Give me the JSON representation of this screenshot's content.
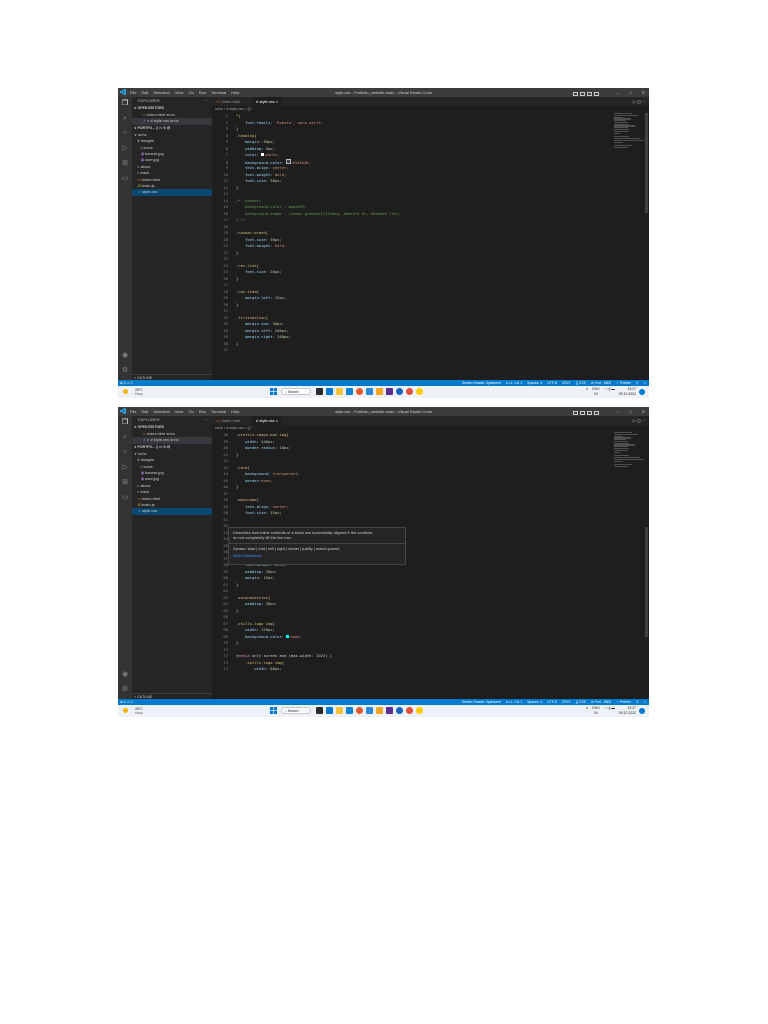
{
  "colors": {
    "accent": "#007acc",
    "selection": "#094771"
  },
  "window": {
    "menu": [
      "File",
      "Edit",
      "Selection",
      "View",
      "Go",
      "Run",
      "Terminal",
      "Help"
    ],
    "title": "style.css - Portfolio_website-main - Visual Studio Code",
    "controls": [
      "–",
      "□",
      "✕"
    ]
  },
  "sidebar": {
    "header": "EXPLORER",
    "open_editors": "OPEN EDITORS",
    "open_files": [
      {
        "label": "index.html  src\\s",
        "icon": "<>",
        "color": "#e37933",
        "active": false
      },
      {
        "label": "× # style.css  src\\s",
        "icon": "#",
        "color": "#519aba",
        "active": true
      }
    ],
    "project": "PORTFO...",
    "tree": [
      {
        "label": "∨ src\\s",
        "indent": 2,
        "icon": "",
        "color": "#cccccc"
      },
      {
        "label": "∨ images",
        "indent": 5,
        "icon": "",
        "color": "#cccccc"
      },
      {
        "label": "> icons",
        "indent": 8,
        "icon": "",
        "color": "#cccccc"
      },
      {
        "label": "banner.jpg",
        "indent": 8,
        "icon": "▣",
        "color": "#a074c4"
      },
      {
        "label": "user.jpg",
        "indent": 8,
        "icon": "▣",
        "color": "#a074c4"
      },
      {
        "label": "> about",
        "indent": 5,
        "icon": "",
        "color": "#cccccc"
      },
      {
        "label": "> track",
        "indent": 5,
        "icon": "",
        "color": "#cccccc"
      },
      {
        "label": "index.html",
        "indent": 5,
        "icon": "<>",
        "color": "#e37933"
      },
      {
        "label": "main.js",
        "indent": 5,
        "icon": "JS",
        "color": "#cbcb41"
      },
      {
        "label": "style.css",
        "indent": 5,
        "icon": "#",
        "color": "#519aba",
        "selected": true
      }
    ],
    "outline": "> OUTLINE",
    "timeline": "> TIMELINE"
  },
  "tabs": [
    {
      "label": "index.html",
      "icon": "<>",
      "color": "#e37933",
      "active": false
    },
    {
      "label": "# style.css  ×",
      "icon": "",
      "color": "#519aba",
      "active": true
    }
  ],
  "tab_actions": "▷  ◫  ···",
  "statusbar": {
    "left": "⊗ 0 ⚠ 0",
    "right": [
      "Screen Reader Optimized",
      "Ln 1, Col 1",
      "Spaces: 4",
      "UTF-8",
      "CRLF",
      "{} CSS",
      "⊘ Port : 5500",
      "✓ Prettier",
      "⚲",
      "♫"
    ]
  },
  "taskbar": {
    "weather_temp": "28°C",
    "weather_desc": "Hazy",
    "search": "Search",
    "lang": "ENG",
    "lang2": "IN",
    "time": "13:27",
    "date": "09-12-2022",
    "apps": [
      "#2b2b2b",
      "#0078d4",
      "#f3c13a",
      "#0a84d6",
      "#e4572e",
      "#2b88d8",
      "#f5a623",
      "#5c2d91",
      "#1565c0",
      "#e44c3c",
      "#ffcc00"
    ]
  },
  "screens": [
    {
      "breadcrumb": "src\\s > # style.css > {} *",
      "code": [
        {
          "n": "1",
          "t": [
            [
              "*{",
              "sel"
            ]
          ]
        },
        {
          "n": "2",
          "t": [
            [
              "    font-family: ",
              "prop"
            ],
            [
              "'Roboto'",
              "val"
            ],
            [
              ", sans-serif;",
              "val"
            ]
          ]
        },
        {
          "n": "3",
          "t": [
            [
              "}",
              "pn"
            ]
          ]
        },
        {
          "n": "4",
          "t": [
            [
              ".heading{",
              "sel"
            ]
          ]
        },
        {
          "n": "5",
          "t": [
            [
              "    margin: ",
              "prop"
            ],
            [
              "50px;",
              "num"
            ]
          ]
        },
        {
          "n": "6",
          "t": [
            [
              "    padding: ",
              "prop"
            ],
            [
              "5px;",
              "num"
            ]
          ]
        },
        {
          "n": "7",
          "t": [
            [
              "    color: ",
              "prop"
            ],
            [
              "■",
              "sw-white"
            ],
            [
              "white;",
              "val"
            ]
          ]
        },
        {
          "n": "8",
          "t": [
            [
              "    background-color: ",
              "prop"
            ],
            [
              "■",
              "sw-dark"
            ],
            [
              "#343a40;",
              "val"
            ]
          ]
        },
        {
          "n": "9",
          "t": [
            [
              "    text-align: ",
              "prop"
            ],
            [
              "center;",
              "val"
            ]
          ]
        },
        {
          "n": "10",
          "t": [
            [
              "    font-weight: ",
              "prop"
            ],
            [
              "bold;",
              "val"
            ]
          ]
        },
        {
          "n": "11",
          "t": [
            [
              "    font-size: ",
              "prop"
            ],
            [
              "30px;",
              "num"
            ]
          ]
        },
        {
          "n": "12",
          "t": [
            [
              "}",
              "pn"
            ]
          ]
        },
        {
          "n": "13",
          "t": []
        },
        {
          "n": "14",
          "t": [
            [
              "/* .navbar{",
              "cmt"
            ]
          ]
        },
        {
          "n": "15",
          "t": [
            [
              "    background-color : #aea3f9;",
              "cmt"
            ]
          ]
        },
        {
          "n": "16",
          "t": [
            [
              "    background-image : linear-gradient(315deg, #aea3f9 0%, #5e6ee6 74%);",
              "cmt"
            ]
          ]
        },
        {
          "n": "17",
          "t": [
            [
              "} */",
              "cmt"
            ]
          ]
        },
        {
          "n": "18",
          "t": []
        },
        {
          "n": "19",
          "t": [
            [
              ".navbar-brand{",
              "sel"
            ]
          ]
        },
        {
          "n": "20",
          "t": [
            [
              "    font-size: ",
              "prop"
            ],
            [
              "30px;",
              "num"
            ]
          ]
        },
        {
          "n": "21",
          "t": [
            [
              "    font-weight: ",
              "prop"
            ],
            [
              "bold;",
              "val"
            ]
          ]
        },
        {
          "n": "22",
          "t": [
            [
              "}",
              "pn"
            ]
          ]
        },
        {
          "n": "23",
          "t": []
        },
        {
          "n": "24",
          "t": [
            [
              ".nav-link{",
              "sel"
            ]
          ]
        },
        {
          "n": "25",
          "t": [
            [
              "    font-size: ",
              "prop"
            ],
            [
              "20px;",
              "num"
            ]
          ]
        },
        {
          "n": "26",
          "t": [
            [
              "}",
              "pn"
            ]
          ]
        },
        {
          "n": "27",
          "t": []
        },
        {
          "n": "28",
          "t": [
            [
              ".nav-item{",
              "sel"
            ]
          ]
        },
        {
          "n": "29",
          "t": [
            [
              "    margin-left: ",
              "prop"
            ],
            [
              "15px;",
              "num"
            ]
          ]
        },
        {
          "n": "30",
          "t": [
            [
              "}",
              "pn"
            ]
          ]
        },
        {
          "n": "31",
          "t": []
        },
        {
          "n": "32",
          "t": [
            [
              ".firstsection{",
              "sel"
            ]
          ]
        },
        {
          "n": "33",
          "t": [
            [
              "    margin-top: ",
              "prop"
            ],
            [
              "90px;",
              "num"
            ]
          ]
        },
        {
          "n": "34",
          "t": [
            [
              "    margin-left: ",
              "prop"
            ],
            [
              "200px;",
              "num"
            ]
          ]
        },
        {
          "n": "35",
          "t": [
            [
              "    margin-right: ",
              "prop"
            ],
            [
              "200px;",
              "num"
            ]
          ]
        },
        {
          "n": "36",
          "t": [
            [
              "}",
              "pn"
            ]
          ]
        },
        {
          "n": "37",
          "t": []
        }
      ],
      "hover": null
    },
    {
      "breadcrumb": "src\\s > # style.css > {} *",
      "code": [
        {
          "n": "38",
          "t": [
            [
              ".profile-image-box img{",
              "sel"
            ]
          ]
        },
        {
          "n": "39",
          "t": [
            [
              "    width: ",
              "prop"
            ],
            [
              "440px;",
              "num"
            ]
          ]
        },
        {
          "n": "40",
          "t": [
            [
              "    border-radius: ",
              "prop"
            ],
            [
              "10px;",
              "num"
            ]
          ]
        },
        {
          "n": "41",
          "t": [
            [
              "}",
              "pn"
            ]
          ]
        },
        {
          "n": "42",
          "t": []
        },
        {
          "n": "43",
          "t": [
            [
              ".card{",
              "sel"
            ]
          ]
        },
        {
          "n": "44",
          "t": [
            [
              "    background: ",
              "prop"
            ],
            [
              "transparent;",
              "val"
            ]
          ]
        },
        {
          "n": "45",
          "t": [
            [
              "    border:",
              "prop"
            ],
            [
              "none;",
              "val"
            ]
          ]
        },
        {
          "n": "46",
          "t": [
            [
              "}",
              "pn"
            ]
          ]
        },
        {
          "n": "47",
          "t": []
        },
        {
          "n": "48",
          "t": [
            [
              ".mainname{",
              "sel"
            ]
          ]
        },
        {
          "n": "49",
          "t": [
            [
              "    text-align: ",
              "prop"
            ],
            [
              "center;",
              "val"
            ]
          ]
        },
        {
          "n": "50",
          "t": [
            [
              "    font-size: ",
              "prop"
            ],
            [
              "35px;",
              "num"
            ]
          ]
        },
        {
          "n": "51",
          "t": []
        },
        {
          "n": "52",
          "t": []
        },
        {
          "n": "53",
          "t": [
            [
              "}",
              "pn"
            ]
          ]
        },
        {
          "n": "54",
          "t": []
        },
        {
          "n": "55",
          "t": [
            [
              ".int",
              "sel"
            ]
          ]
        },
        {
          "n": "56",
          "t": [
            [
              "    text-align: ",
              "prop"
            ],
            [
              "center;",
              "val"
            ]
          ]
        },
        {
          "n": "57",
          "t": [
            [
              "    font-size: ",
              "prop"
            ],
            [
              "20px;",
              "num"
            ]
          ]
        },
        {
          "n": "58",
          "t": [
            [
              "    font-weight: ",
              "prop"
            ],
            [
              "bold;",
              "val"
            ]
          ]
        },
        {
          "n": "59",
          "t": [
            [
              "    padding: ",
              "prop"
            ],
            [
              "10px;",
              "num"
            ]
          ]
        },
        {
          "n": "60",
          "t": [
            [
              "    margin: ",
              "prop"
            ],
            [
              "15px;",
              "num"
            ]
          ]
        },
        {
          "n": "61",
          "t": [
            [
              "}",
              "pn"
            ]
          ]
        },
        {
          "n": "62",
          "t": []
        },
        {
          "n": "63",
          "t": [
            [
              ".secondsection{",
              "sel"
            ]
          ]
        },
        {
          "n": "64",
          "t": [
            [
              "    padding: ",
              "prop"
            ],
            [
              "20px;",
              "num"
            ]
          ]
        },
        {
          "n": "65",
          "t": [
            [
              "}",
              "pn"
            ]
          ]
        },
        {
          "n": "66",
          "t": []
        },
        {
          "n": "67",
          "t": [
            [
              ".skills-logo img{",
              "sel"
            ]
          ]
        },
        {
          "n": "68",
          "t": [
            [
              "    width: ",
              "prop"
            ],
            [
              "120px;",
              "num"
            ]
          ]
        },
        {
          "n": "69",
          "t": [
            [
              "    background-color: ",
              "prop"
            ],
            [
              "■",
              "sw-aqua"
            ],
            [
              "aqua;",
              "val"
            ]
          ]
        },
        {
          "n": "70",
          "t": [
            [
              "}",
              "pn"
            ]
          ]
        },
        {
          "n": "71",
          "t": []
        },
        {
          "n": "72",
          "t": [
            [
              "@media ",
              "kw"
            ],
            [
              "only screen and (max-width: ",
              "pn"
            ],
            [
              "1024",
              "num"
            ],
            [
              ") {",
              "pn"
            ]
          ]
        },
        {
          "n": "73",
          "t": [
            [
              "    .skills-logo img{",
              "sel"
            ]
          ]
        },
        {
          "n": "74",
          "t": [
            [
              "        width: ",
              "prop"
            ],
            [
              "80px;",
              "num"
            ]
          ]
        }
      ],
      "hover": {
        "line1": "Describes how inline contents of a block are horizontally aligned if the contents",
        "line2": "do not completely fill the line box.",
        "syntax": "Syntax: start | end | left | right | center | justify | match-parent",
        "link": "MDN Reference"
      }
    }
  ]
}
